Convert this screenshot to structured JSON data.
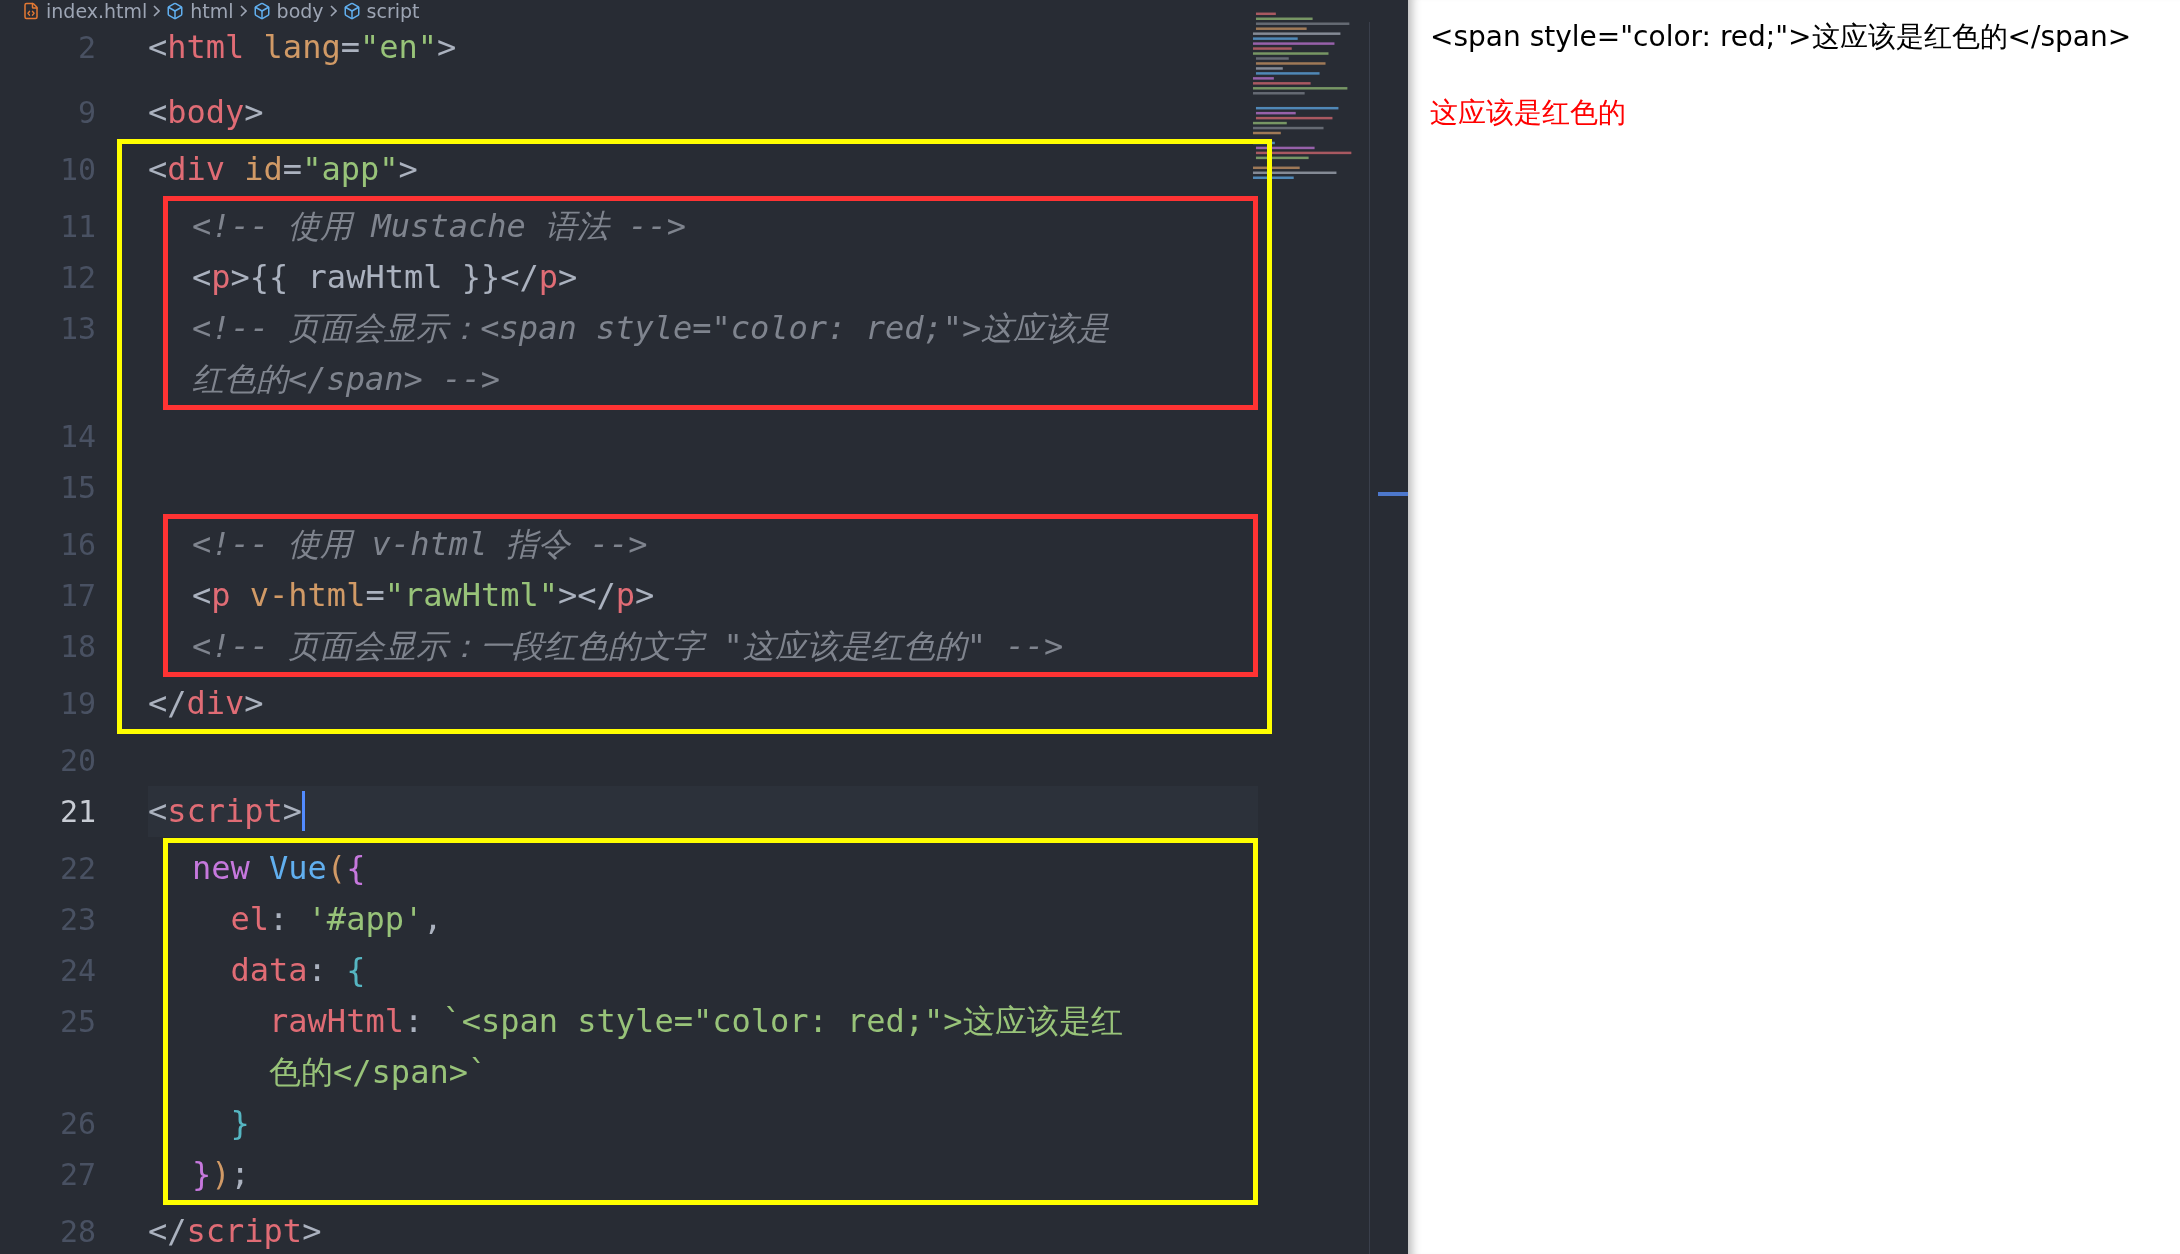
{
  "breadcrumb": [
    {
      "kind": "file",
      "label": "index.html"
    },
    {
      "kind": "symbol",
      "label": "html"
    },
    {
      "kind": "symbol",
      "label": "body"
    },
    {
      "kind": "symbol",
      "label": "script"
    }
  ],
  "editor": {
    "blocks": [
      {
        "kind": "line",
        "number": "2",
        "current": false,
        "rows": [
          [
            {
              "kind": "p",
              "text": "<"
            },
            {
              "kind": "tag",
              "text": "html"
            },
            {
              "kind": "p",
              "text": " "
            },
            {
              "kind": "attr",
              "text": "lang"
            },
            {
              "kind": "p",
              "text": "="
            },
            {
              "kind": "str",
              "text": "\"en\""
            },
            {
              "kind": "p",
              "text": ">"
            }
          ]
        ]
      },
      {
        "kind": "fold"
      },
      {
        "kind": "line",
        "number": "9",
        "current": false,
        "rows": [
          [
            {
              "kind": "p",
              "text": "<"
            },
            {
              "kind": "tag",
              "text": "body"
            },
            {
              "kind": "p",
              "text": ">"
            }
          ]
        ]
      },
      {
        "kind": "frame",
        "color": "#ffff00",
        "children": [
          {
            "kind": "line",
            "number": "10",
            "current": false,
            "rows": [
              [
                {
                  "kind": "p",
                  "text": "<"
                },
                {
                  "kind": "tag",
                  "text": "div"
                },
                {
                  "kind": "p",
                  "text": " "
                },
                {
                  "kind": "attr",
                  "text": "id"
                },
                {
                  "kind": "p",
                  "text": "="
                },
                {
                  "kind": "str",
                  "text": "\"app\""
                },
                {
                  "kind": "p",
                  "text": ">"
                }
              ]
            ]
          },
          {
            "kind": "inset_frame",
            "color": "#ff3333",
            "children": [
              {
                "kind": "line",
                "number": "11",
                "current": false,
                "rows": [
                  [
                    {
                      "kind": "cm",
                      "text": "<!-- 使用 Mustache 语法 -->"
                    }
                  ]
                ]
              },
              {
                "kind": "line",
                "number": "12",
                "current": false,
                "rows": [
                  [
                    {
                      "kind": "p",
                      "text": "<"
                    },
                    {
                      "kind": "tag",
                      "text": "p"
                    },
                    {
                      "kind": "p",
                      "text": ">{{ rawHtml }}</"
                    },
                    {
                      "kind": "tag",
                      "text": "p"
                    },
                    {
                      "kind": "p",
                      "text": ">"
                    }
                  ]
                ]
              },
              {
                "kind": "line",
                "number": "13",
                "current": false,
                "rows": [
                  [
                    {
                      "kind": "cm",
                      "text": "<!-- 页面会显示：<span style=\"color: red;\">这应该是"
                    }
                  ],
                  [
                    {
                      "kind": "cm",
                      "text": "红色的</span> -->"
                    }
                  ]
                ]
              }
            ]
          },
          {
            "kind": "line",
            "number": "14",
            "current": false,
            "rows": [
              []
            ]
          },
          {
            "kind": "line",
            "number": "15",
            "current": false,
            "rows": [
              []
            ]
          },
          {
            "kind": "inset_frame",
            "color": "#ff3333",
            "children": [
              {
                "kind": "line",
                "number": "16",
                "current": false,
                "rows": [
                  [
                    {
                      "kind": "cm",
                      "text": "<!-- 使用 v-html 指令 -->"
                    }
                  ]
                ]
              },
              {
                "kind": "line",
                "number": "17",
                "current": false,
                "rows": [
                  [
                    {
                      "kind": "p",
                      "text": "<"
                    },
                    {
                      "kind": "tag",
                      "text": "p"
                    },
                    {
                      "kind": "p",
                      "text": " "
                    },
                    {
                      "kind": "attr",
                      "text": "v-html"
                    },
                    {
                      "kind": "p",
                      "text": "="
                    },
                    {
                      "kind": "str",
                      "text": "\"rawHtml\""
                    },
                    {
                      "kind": "p",
                      "text": "></"
                    },
                    {
                      "kind": "tag",
                      "text": "p"
                    },
                    {
                      "kind": "p",
                      "text": ">"
                    }
                  ]
                ]
              },
              {
                "kind": "line",
                "number": "18",
                "current": false,
                "rows": [
                  [
                    {
                      "kind": "cm",
                      "text": "<!-- 页面会显示：一段红色的文字 \"这应该是红色的\" -->"
                    }
                  ]
                ]
              }
            ]
          },
          {
            "kind": "line",
            "number": "19",
            "current": false,
            "rows": [
              [
                {
                  "kind": "p",
                  "text": "</"
                },
                {
                  "kind": "tag",
                  "text": "div"
                },
                {
                  "kind": "p",
                  "text": ">"
                }
              ]
            ]
          }
        ]
      },
      {
        "kind": "line",
        "number": "20",
        "current": false,
        "rows": [
          []
        ]
      },
      {
        "kind": "line",
        "number": "21",
        "current": true,
        "rows": [
          [
            {
              "kind": "p",
              "text": "<"
            },
            {
              "kind": "tag",
              "text": "script"
            },
            {
              "kind": "p",
              "text": ">"
            }
          ]
        ]
      },
      {
        "kind": "inset_frame",
        "color": "#ffff00",
        "children": [
          {
            "kind": "line",
            "number": "22",
            "current": false,
            "rows": [
              [
                {
                  "kind": "kw",
                  "text": "new"
                },
                {
                  "kind": "p",
                  "text": " "
                },
                {
                  "kind": "fn",
                  "text": "Vue"
                },
                {
                  "kind": "b2",
                  "text": "("
                },
                {
                  "kind": "b1",
                  "text": "{"
                }
              ]
            ]
          },
          {
            "kind": "line",
            "number": "23",
            "current": false,
            "rows": [
              [
                {
                  "kind": "p",
                  "text": "  "
                },
                {
                  "kind": "prop",
                  "text": "el"
                },
                {
                  "kind": "p",
                  "text": ": "
                },
                {
                  "kind": "str",
                  "text": "'#app'"
                },
                {
                  "kind": "p",
                  "text": ","
                }
              ]
            ]
          },
          {
            "kind": "line",
            "number": "24",
            "current": false,
            "rows": [
              [
                {
                  "kind": "p",
                  "text": "  "
                },
                {
                  "kind": "prop",
                  "text": "data"
                },
                {
                  "kind": "p",
                  "text": ": "
                },
                {
                  "kind": "b3",
                  "text": "{"
                }
              ]
            ]
          },
          {
            "kind": "line",
            "number": "25",
            "current": false,
            "rows": [
              [
                {
                  "kind": "p",
                  "text": "    "
                },
                {
                  "kind": "prop",
                  "text": "rawHtml"
                },
                {
                  "kind": "p",
                  "text": ": "
                },
                {
                  "kind": "str",
                  "text": "`<span style=\"color: red;\">这应该是红"
                }
              ],
              [
                {
                  "kind": "p",
                  "text": "    "
                },
                {
                  "kind": "str",
                  "text": "色的</span>`"
                }
              ]
            ]
          },
          {
            "kind": "line",
            "number": "26",
            "current": false,
            "rows": [
              [
                {
                  "kind": "p",
                  "text": "  "
                },
                {
                  "kind": "b3",
                  "text": "}"
                }
              ]
            ]
          },
          {
            "kind": "line",
            "number": "27",
            "current": false,
            "rows": [
              [
                {
                  "kind": "b1",
                  "text": "}"
                },
                {
                  "kind": "b2",
                  "text": ")"
                },
                {
                  "kind": "p",
                  "text": ";"
                }
              ]
            ]
          }
        ]
      },
      {
        "kind": "line",
        "number": "28",
        "current": false,
        "rows": [
          [
            {
              "kind": "p",
              "text": "</"
            },
            {
              "kind": "tag",
              "text": "script"
            },
            {
              "kind": "p",
              "text": ">"
            }
          ]
        ]
      }
    ]
  },
  "preview": [
    {
      "text": "<span style=\"color: red;\">这应该是红色的</span>",
      "color": "#000000"
    },
    {
      "text": "这应该是红色的",
      "color": "#ff0000"
    }
  ]
}
